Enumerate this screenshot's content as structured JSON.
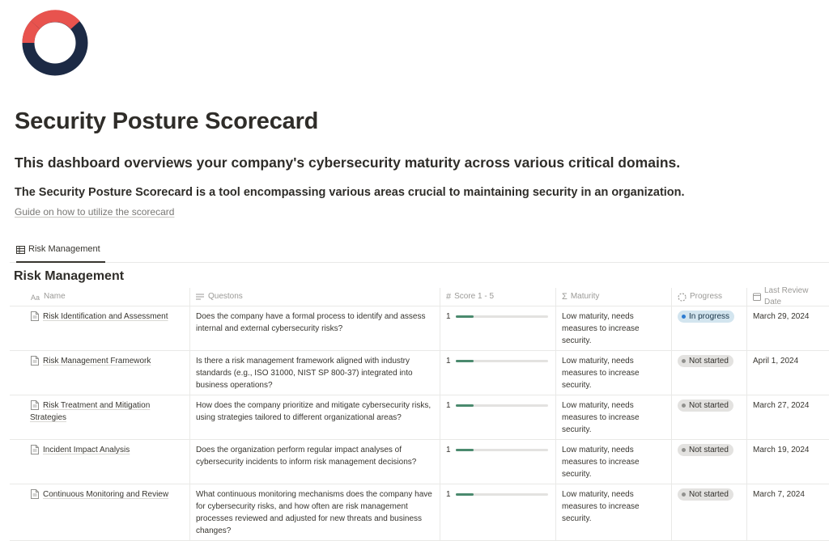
{
  "page": {
    "title": "Security Posture Scorecard",
    "subtitle": "This dashboard overviews your company's cybersecurity maturity across various critical domains.",
    "description": "The Security Posture Scorecard is a tool encompassing various areas crucial to maintaining security in an organization.",
    "guide_link": "Guide on how to utilize the scorecard"
  },
  "logo": {
    "colors": {
      "ring_main": "#1c2a45",
      "ring_accent": "#e8534e"
    }
  },
  "tabs": [
    {
      "label": "Risk Management",
      "icon": "table-icon",
      "active": true
    }
  ],
  "section": {
    "title": "Risk Management"
  },
  "table": {
    "columns": {
      "name": "Name",
      "questions": "Questons",
      "score": "Score 1 - 5",
      "maturity": "Maturity",
      "progress": "Progress",
      "last_review": "Last Review Date"
    },
    "rows": [
      {
        "name": "Risk Identification and Assessment",
        "question": "Does the company have a formal process to identify and assess internal and external cybersecurity risks?",
        "score": "1",
        "score_fraction": 0.2,
        "maturity": "Low maturity, needs measures to increase security.",
        "progress": "In progress",
        "progress_color": "blue",
        "date": "March 29, 2024"
      },
      {
        "name": "Risk Management Framework",
        "question": "Is there a risk management framework aligned with industry standards (e.g., ISO 31000, NIST SP 800-37) integrated into business operations?",
        "score": "1",
        "score_fraction": 0.2,
        "maturity": "Low maturity, needs measures to increase security.",
        "progress": "Not started",
        "progress_color": "gray",
        "date": "April 1, 2024"
      },
      {
        "name": "Risk Treatment and Mitigation Strategies",
        "question": "How does the company prioritize and mitigate cybersecurity risks, using strategies tailored to different organizational areas?",
        "score": "1",
        "score_fraction": 0.2,
        "maturity": "Low maturity, needs measures to increase security.",
        "progress": "Not started",
        "progress_color": "gray",
        "date": "March 27, 2024"
      },
      {
        "name": "Incident Impact Analysis",
        "question": "Does the organization perform regular impact analyses of cybersecurity incidents to inform risk management decisions?",
        "score": "1",
        "score_fraction": 0.2,
        "maturity": "Low maturity, needs measures to increase security.",
        "progress": "Not started",
        "progress_color": "gray",
        "date": "March 19, 2024"
      },
      {
        "name": "Continuous Monitoring and Review",
        "question": "What continuous monitoring mechanisms does the company have for cybersecurity risks, and how often are risk management processes reviewed and adjusted for new threats and business changes?",
        "score": "1",
        "score_fraction": 0.2,
        "maturity": "Low maturity, needs measures to increase security.",
        "progress": "Not started",
        "progress_color": "gray",
        "date": "March 7, 2024"
      }
    ]
  }
}
